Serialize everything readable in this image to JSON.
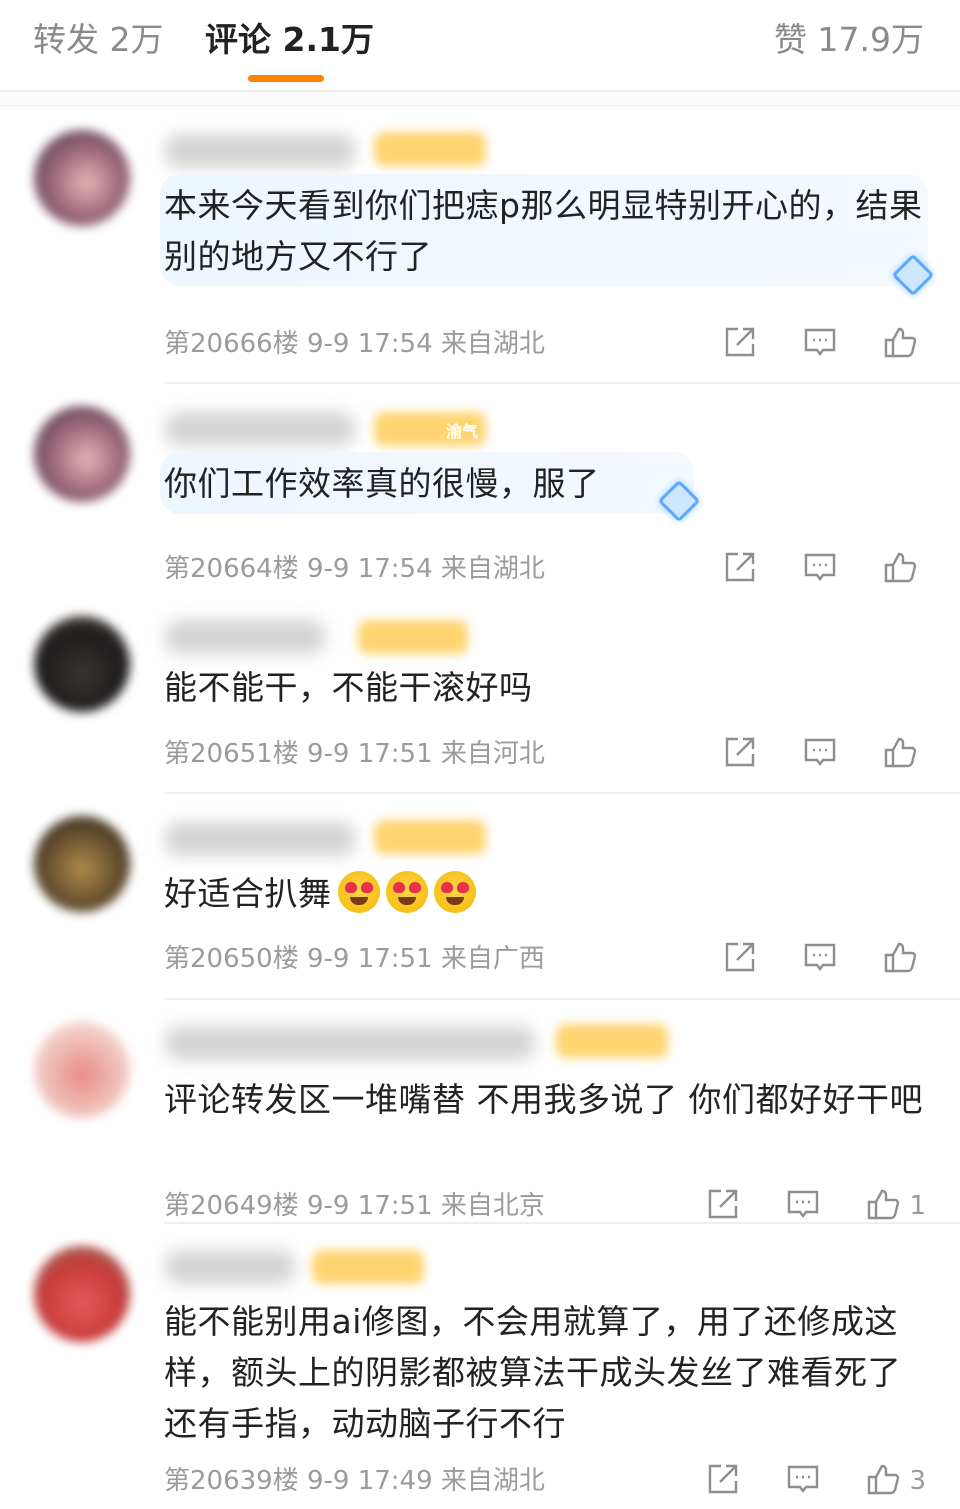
{
  "tabs": {
    "repost": "转发 2万",
    "comment": "评论 2.1万",
    "like": "赞 17.9万"
  },
  "colors": {
    "accent": "#ff8200",
    "meta": "#9b9b9b",
    "bubble": "#eef6ff"
  },
  "comments": [
    {
      "text": "本来今天看到你们把痣p那么明显特别开心的，结果别的地方又不行了",
      "meta": "第20666楼 9-9 17:54 来自湖北",
      "like_count": ""
    },
    {
      "badge": "渝气",
      "text": "你们工作效率真的很慢，服了",
      "meta": "第20664楼 9-9 17:54 来自湖北",
      "like_count": ""
    },
    {
      "text": "能不能干，不能干滚好吗",
      "meta": "第20651楼 9-9 17:51 来自河北",
      "like_count": ""
    },
    {
      "text": "好适合扒舞",
      "meta": "第20650楼 9-9 17:51 来自广西",
      "like_count": ""
    },
    {
      "text": "评论转发区一堆嘴替 不用我多说了 你们都好好干吧",
      "meta": "第20649楼 9-9 17:51 来自北京",
      "like_count": "1"
    },
    {
      "text": "能不能别用ai修图，不会用就算了，用了还修成这样，额头上的阴影都被算法干成头发丝了难看死了还有手指，动动脑子行不行",
      "meta": "第20639楼 9-9 17:49 来自湖北",
      "like_count": "3"
    }
  ],
  "icons": {
    "share": "share-icon",
    "reply": "comment-icon",
    "like": "thumbs-up-icon",
    "emoji": "heart-eyes-emoji-icon",
    "badge": "diamond-badge-icon"
  }
}
